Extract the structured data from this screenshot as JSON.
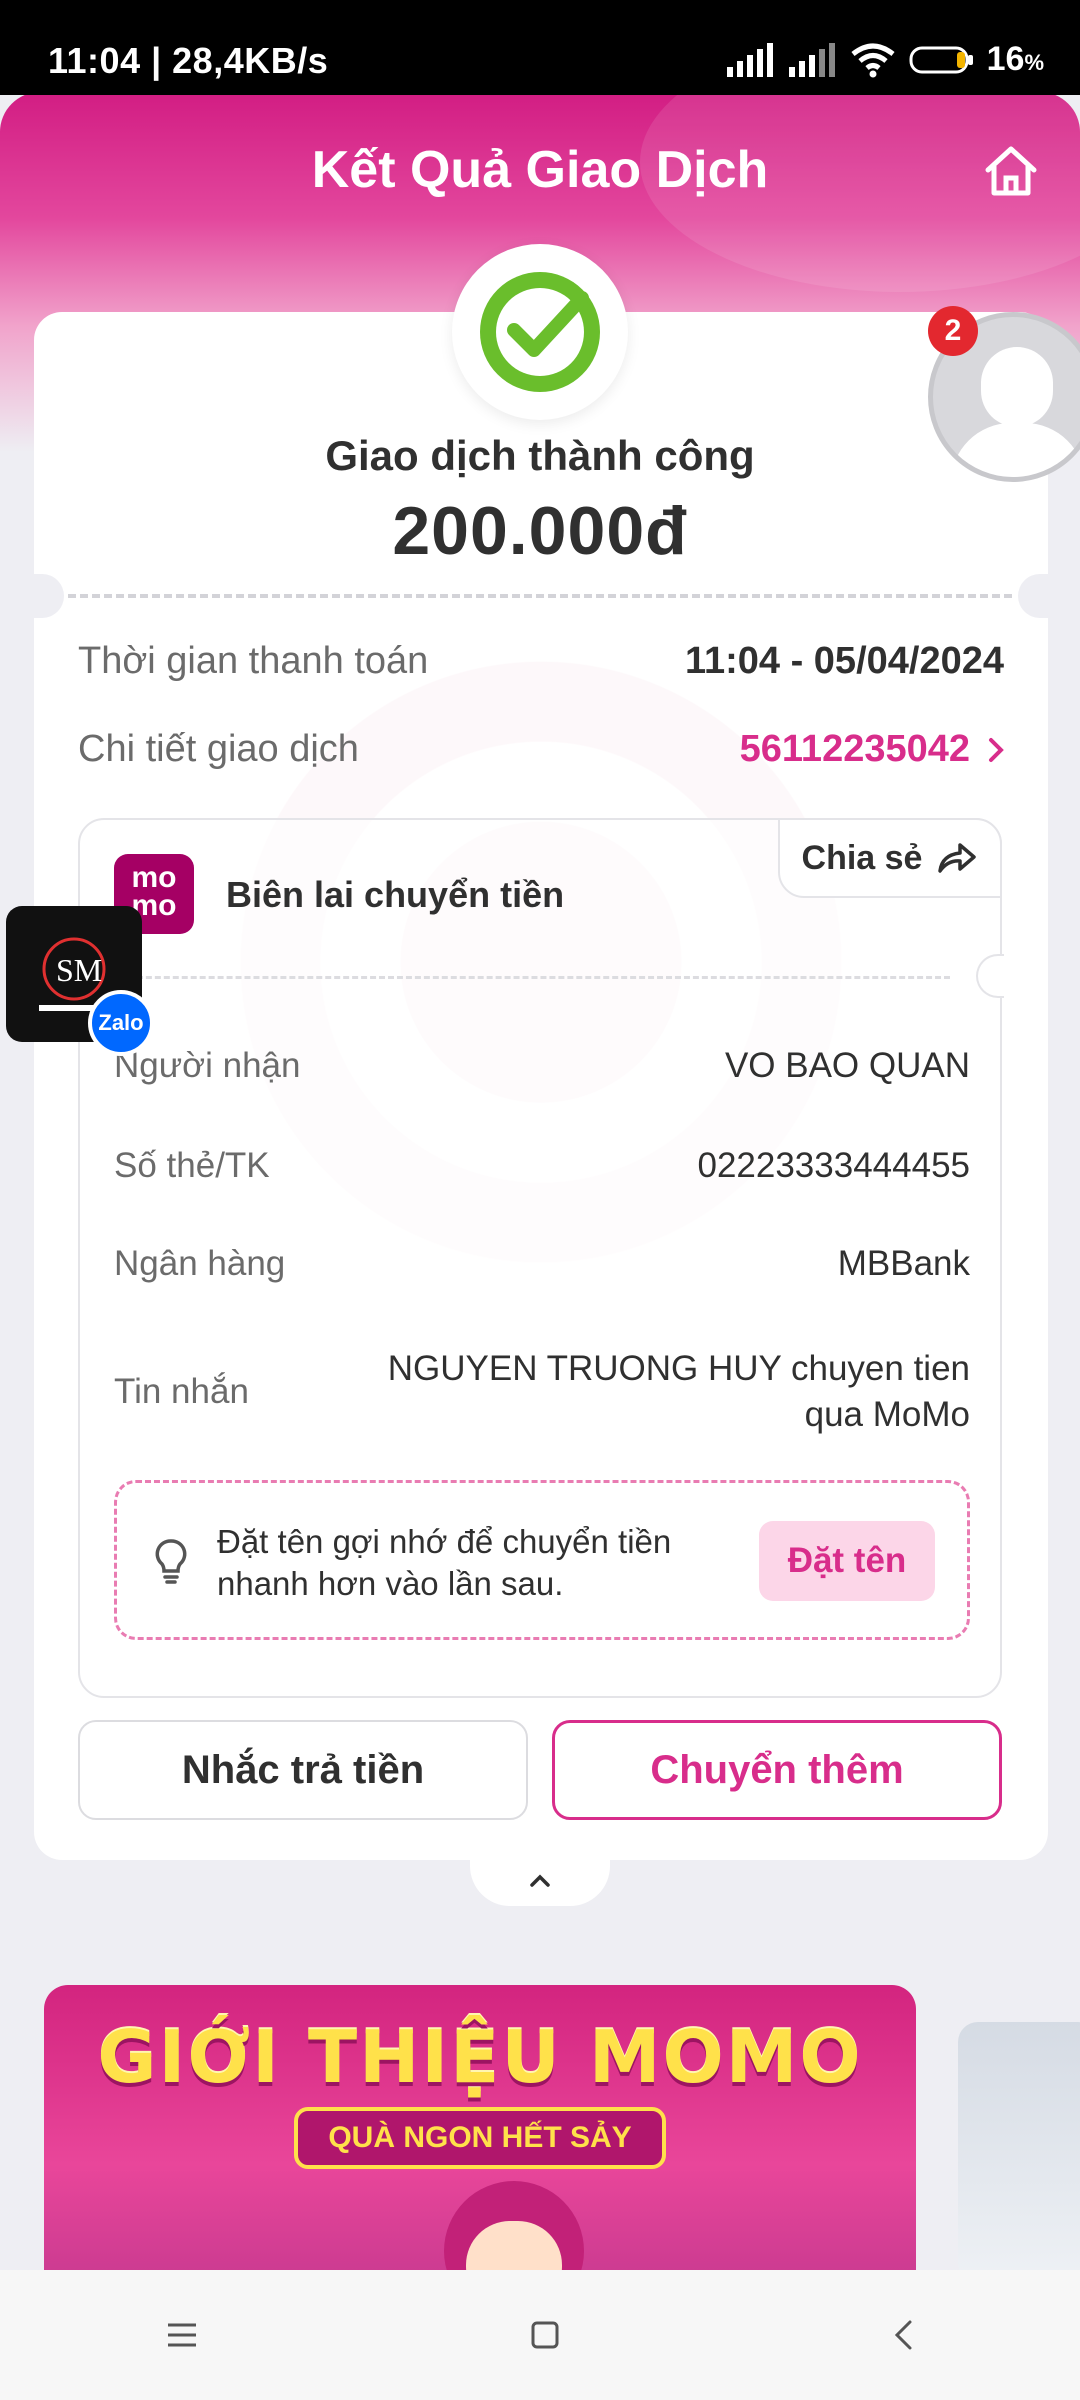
{
  "status_bar": {
    "time_speed": "11:04 | 28,4KB/s",
    "battery": "16",
    "battery_unit": "%"
  },
  "header": {
    "title": "Kết Quả Giao Dịch"
  },
  "result": {
    "status_text": "Giao dịch thành công",
    "amount": "200.000đ"
  },
  "details": {
    "time_label": "Thời gian thanh toán",
    "time_value": "11:04 - 05/04/2024",
    "transaction_label": "Chi tiết giao dịch",
    "transaction_id": "56112235042"
  },
  "receipt": {
    "logo_text_top": "mo",
    "logo_text_bottom": "mo",
    "title": "Biên lai chuyển tiền",
    "share_label": "Chia sẻ",
    "rows": [
      {
        "label": "Người nhận",
        "value": "VO BAO QUAN"
      },
      {
        "label": "Số thẻ/TK",
        "value": "02223333444455"
      },
      {
        "label": "Ngân hàng",
        "value": "MBBank"
      },
      {
        "label": "Tin nhắn",
        "value": "NGUYEN TRUONG HUY chuyen tien qua MoMo"
      }
    ],
    "hint_text": "Đặt tên gợi nhớ để chuyển tiền nhanh hơn vào lần sau.",
    "name_button": "Đặt tên"
  },
  "actions": {
    "remind": "Nhắc trả tiền",
    "transfer_more": "Chuyển thêm"
  },
  "banner": {
    "title": "GIỚI THIỆU MOMO",
    "subtitle": "QUÀ NGON HẾT SẢY"
  },
  "overlays": {
    "zalo_label": "Zalo",
    "avatar_badge_count": "2"
  }
}
